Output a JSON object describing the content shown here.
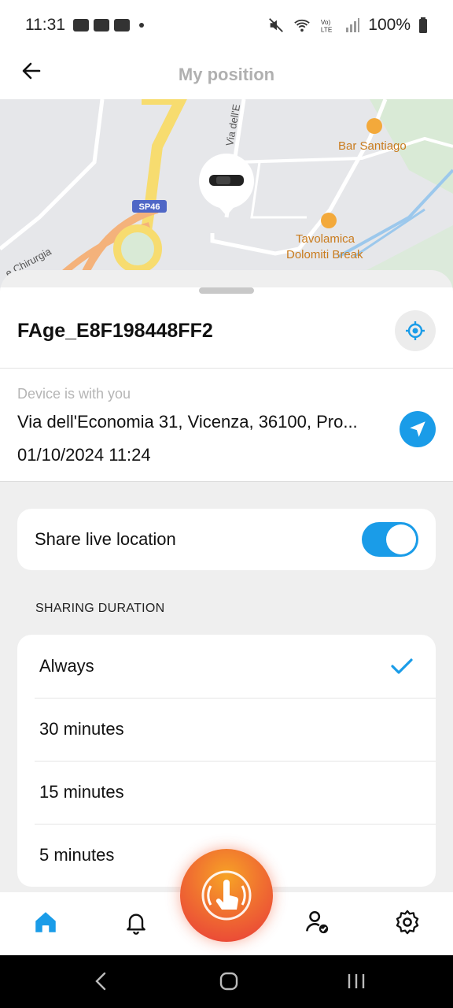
{
  "status_bar": {
    "time": "11:31",
    "battery": "100%",
    "icons": [
      "gallery-icon",
      "youtube-icon",
      "youtube-icon",
      "dot-icon",
      "mute-icon",
      "wifi-icon",
      "volte-icon",
      "signal-icon",
      "battery-icon"
    ]
  },
  "header": {
    "title": "My position",
    "back_icon": "arrow-left-icon"
  },
  "map": {
    "labels": {
      "road_ref": "SP46",
      "street_1": "Via dell'E",
      "street_2": "e Chirurgia",
      "poi_1": "Bar Santiago",
      "poi_2_line1": "Tavolamica",
      "poi_2_line2": "Dolomiti Break"
    }
  },
  "device": {
    "name": "FAge_E8F198448FF2",
    "caption": "Device is with you",
    "address": "Via dell'Economia 31, Vicenza, 36100, Pro...",
    "datetime": "01/10/2024 11:24"
  },
  "share": {
    "label": "Share live location",
    "enabled": true
  },
  "duration": {
    "section_label": "SHARING DURATION",
    "options": [
      {
        "label": "Always",
        "selected": true
      },
      {
        "label": "30 minutes",
        "selected": false
      },
      {
        "label": "15 minutes",
        "selected": false
      },
      {
        "label": "5 minutes",
        "selected": false
      }
    ]
  },
  "bottom_nav": {
    "items": [
      "home-icon",
      "bell-icon",
      "sos-button",
      "user-check-icon",
      "gear-icon"
    ],
    "active": "home-icon"
  },
  "colors": {
    "accent": "#1a9ce8",
    "sos_start": "#f7a326",
    "sos_end": "#e8393a",
    "title_gray": "#b0b0b0"
  }
}
